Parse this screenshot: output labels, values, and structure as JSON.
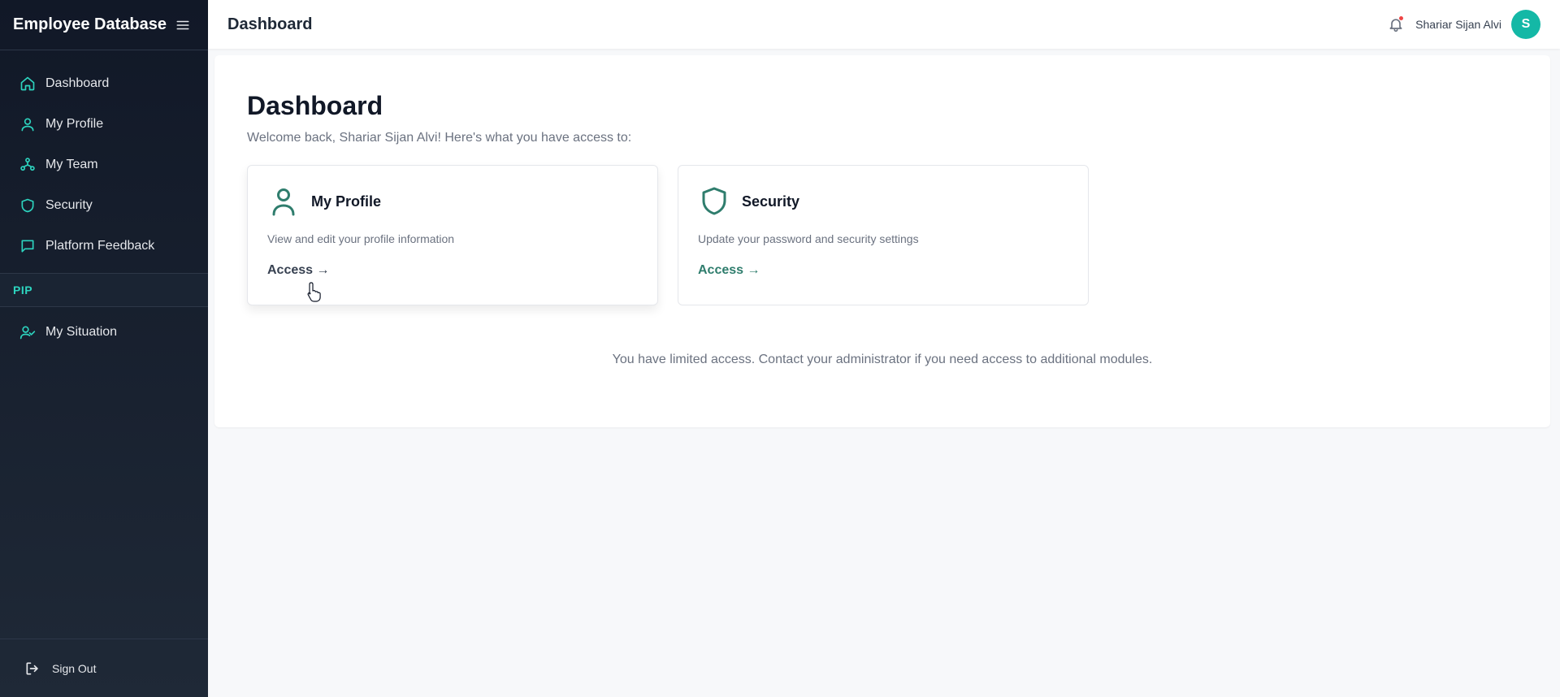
{
  "sidebar": {
    "brand": "Employee Database",
    "items": [
      {
        "label": "Dashboard",
        "icon": "home-icon"
      },
      {
        "label": "My Profile",
        "icon": "user-icon"
      },
      {
        "label": "My Team",
        "icon": "team-icon"
      },
      {
        "label": "Security",
        "icon": "shield-icon"
      },
      {
        "label": "Platform Feedback",
        "icon": "message-square-icon"
      }
    ],
    "section": {
      "label": "PIP",
      "items": [
        {
          "label": "My Situation",
          "icon": "user-check-icon"
        }
      ]
    },
    "footer": {
      "label": "Sign Out",
      "icon": "sign-out-icon"
    }
  },
  "header": {
    "title": "Dashboard",
    "user_name": "Shariar Sijan Alvi",
    "avatar_initial": "S"
  },
  "main": {
    "title": "Dashboard",
    "welcome": "Welcome back, Shariar Sijan Alvi! Here's what you have access to:",
    "cards": [
      {
        "title": "My Profile",
        "description": "View and edit your profile information",
        "link": "Access →",
        "icon": "user-icon"
      },
      {
        "title": "Security",
        "description": "Update your password and security settings",
        "link": "Access →",
        "icon": "shield-icon"
      }
    ],
    "notice": "You have limited access. Contact your administrator if you need access to additional modules."
  },
  "colors": {
    "sidebar_bg": "#111827",
    "accent": "#2dd4bf",
    "card_icon": "#2f7d6d",
    "avatar_bg": "#14b8a6",
    "notification_dot": "#ef4444"
  }
}
